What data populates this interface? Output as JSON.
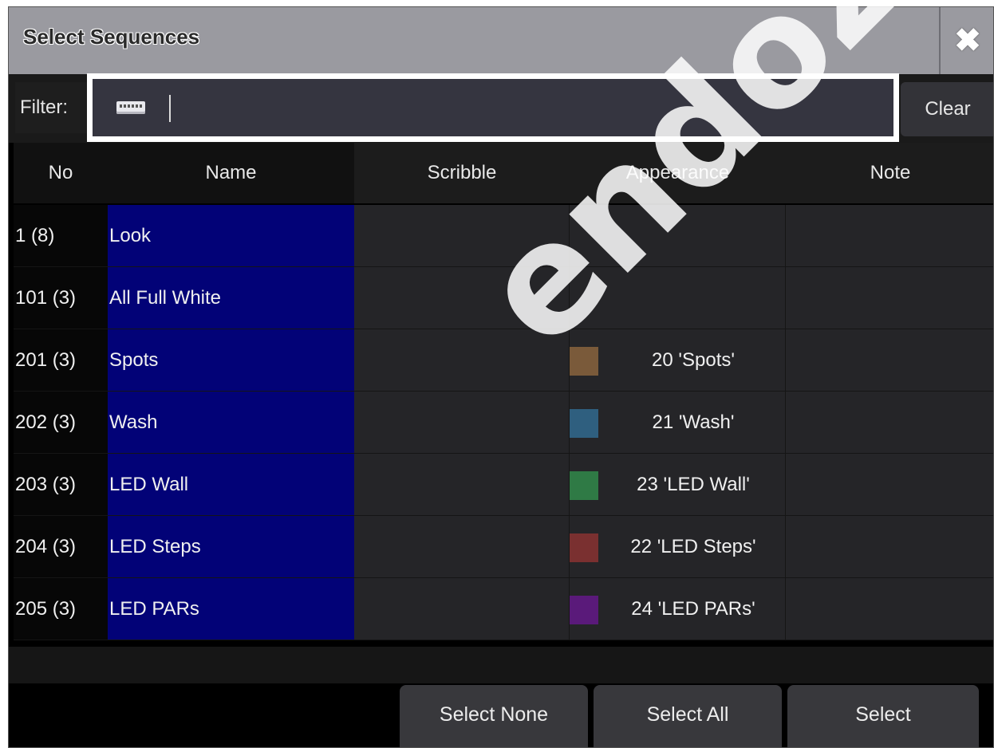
{
  "dialog": {
    "title": "Select Sequences",
    "close_icon": "close-icon"
  },
  "filter": {
    "label": "Filter:",
    "value": "",
    "keyboard_icon": "keyboard-icon",
    "clear_label": "Clear"
  },
  "table": {
    "headers": [
      "No",
      "Name",
      "Scribble",
      "Appearance",
      "Note"
    ],
    "rows": [
      {
        "no": "1 (8)",
        "name": "Look",
        "scribble": "",
        "appearance": "",
        "swatch": "",
        "note": ""
      },
      {
        "no": "101 (3)",
        "name": "All Full White",
        "scribble": "",
        "appearance": "",
        "swatch": "",
        "note": ""
      },
      {
        "no": "201 (3)",
        "name": "Spots",
        "scribble": "",
        "appearance": "20 'Spots'",
        "swatch": "#7a5a3a",
        "note": ""
      },
      {
        "no": "202 (3)",
        "name": "Wash",
        "scribble": "",
        "appearance": "21 'Wash'",
        "swatch": "#2f5f7f",
        "note": ""
      },
      {
        "no": "203 (3)",
        "name": "LED Wall",
        "scribble": "",
        "appearance": "23 'LED Wall'",
        "swatch": "#2f7a45",
        "note": ""
      },
      {
        "no": "204 (3)",
        "name": "LED Steps",
        "scribble": "",
        "appearance": "22 'LED Steps'",
        "swatch": "#7a3030",
        "note": ""
      },
      {
        "no": "205 (3)",
        "name": "LED PARs",
        "scribble": "",
        "appearance": "24 'LED PARs'",
        "swatch": "#5a1a7a",
        "note": ""
      }
    ]
  },
  "buttons": {
    "select_none": "Select None",
    "select_all": "Select All",
    "select": "Select"
  },
  "watermark": "endoza.com",
  "colors": {
    "name_cell": "#020277",
    "titlebar": "#9a9aa0",
    "highlight_border": "#ffffff"
  }
}
